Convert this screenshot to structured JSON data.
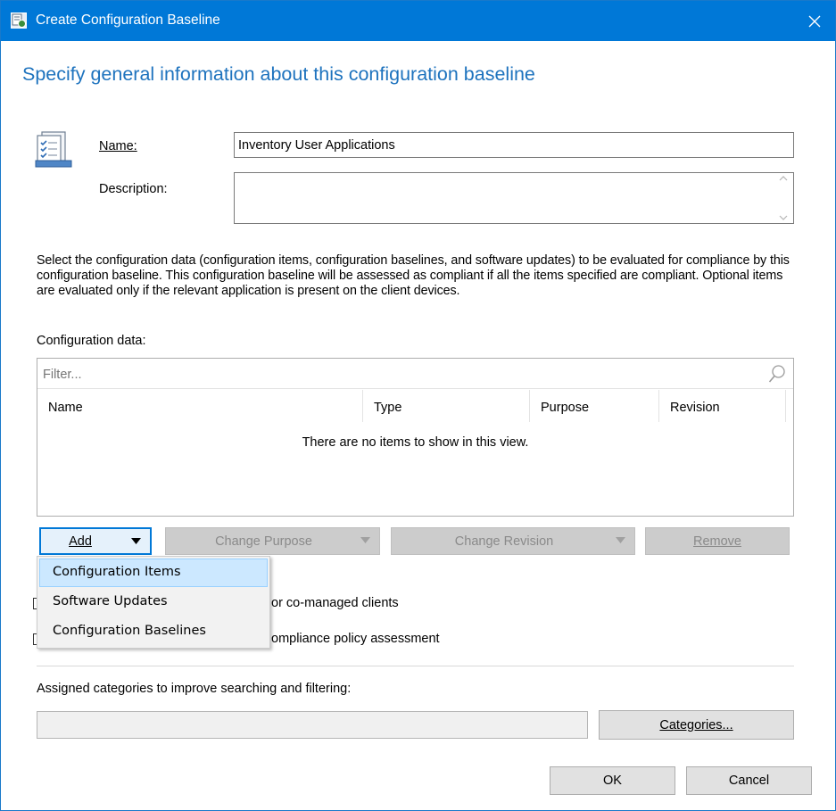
{
  "window": {
    "title": "Create Configuration Baseline"
  },
  "page": {
    "heading": "Specify general information about this configuration baseline"
  },
  "form": {
    "name_label": "Name:",
    "name_value": "Inventory User Applications",
    "description_label": "Description:",
    "description_value": ""
  },
  "instructions": "Select the configuration data (configuration items, configuration baselines, and software updates) to be evaluated for compliance by this configuration baseline. This configuration baseline will be assessed as compliant if all the items specified are compliant. Optional items are evaluated only if the relevant application is present on  the client devices.",
  "config_data": {
    "label": "Configuration data:",
    "filter_placeholder": "Filter...",
    "columns": [
      "Name",
      "Type",
      "Purpose",
      "Revision"
    ],
    "empty_message": "There are no items to show in this view."
  },
  "buttons": {
    "add": "Add",
    "change_purpose": "Change Purpose",
    "change_revision": "Change Revision",
    "remove": "Remove",
    "categories": "Categories...",
    "ok": "OK",
    "cancel": "Cancel"
  },
  "add_menu": {
    "items": [
      "Configuration Items",
      "Software Updates",
      "Configuration Baselines"
    ],
    "highlighted_index": 0
  },
  "checkboxes": {
    "first_visible_text": "or co-managed clients",
    "second_visible_text": "ompliance policy assessment"
  },
  "categories": {
    "label": "Assigned categories to improve searching and filtering:",
    "value": ""
  },
  "colors": {
    "titlebar": "#0078d7",
    "heading": "#1e73be",
    "menu_highlight": "#cce8ff"
  }
}
